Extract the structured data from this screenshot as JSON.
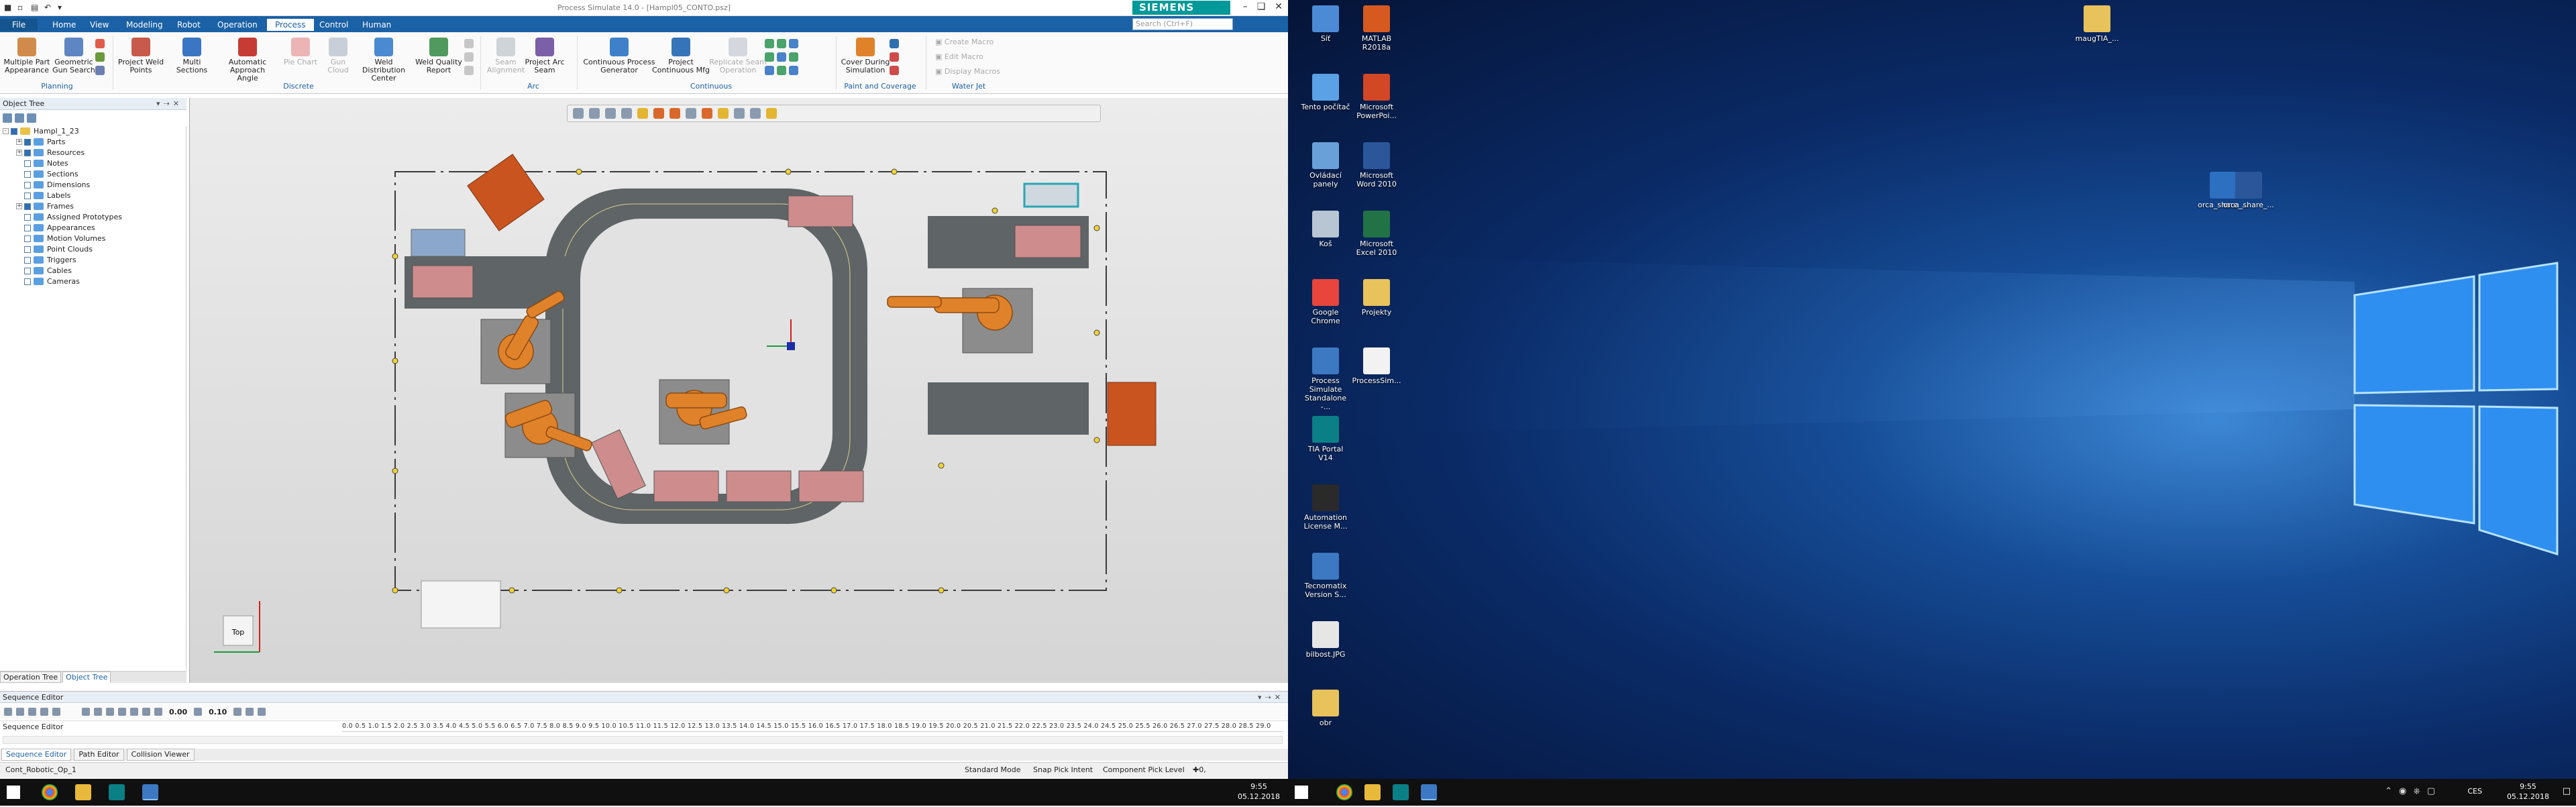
{
  "app": {
    "title": "Process Simulate 14.0 - [Hampl05_CONTO.psz]",
    "brand": "SIEMENS",
    "search_placeholder": "Search (Ctrl+F)",
    "tabs": [
      "File",
      "Home",
      "View",
      "Modeling",
      "Robot",
      "Operation",
      "Process",
      "Control",
      "Human"
    ],
    "active_tab": "Process"
  },
  "ribbon": {
    "buttons": [
      {
        "label": "Multiple Part Appearance",
        "icon": "multiple-part-appearance-icon",
        "disabled": false
      },
      {
        "label": "Geometric Gun Search",
        "icon": "geometric-gun-search-icon",
        "disabled": false
      },
      {
        "label": "Project Weld Points",
        "icon": "project-weld-points-icon",
        "disabled": false
      },
      {
        "label": "Multi Sections",
        "icon": "multi-sections-icon",
        "disabled": false
      },
      {
        "label": "Automatic Approach Angle",
        "icon": "approach-angle-icon",
        "disabled": false
      },
      {
        "label": "Pie Chart",
        "icon": "pie-chart-icon",
        "disabled": true
      },
      {
        "label": "Gun Cloud",
        "icon": "gun-cloud-icon",
        "disabled": true
      },
      {
        "label": "Weld Distribution Center",
        "icon": "weld-distribution-icon",
        "disabled": false
      },
      {
        "label": "Weld Quality Report",
        "icon": "weld-quality-icon",
        "disabled": false
      },
      {
        "label": "Seam Alignment",
        "icon": "seam-alignment-icon",
        "disabled": true
      },
      {
        "label": "Project Arc Seam",
        "icon": "project-arc-seam-icon",
        "disabled": false
      },
      {
        "label": "Continuous Process Generator",
        "icon": "continuous-process-icon",
        "disabled": false
      },
      {
        "label": "Project Continuous Mfg",
        "icon": "project-continuous-icon",
        "disabled": false
      },
      {
        "label": "Replicate Seam Operation",
        "icon": "replicate-seam-icon",
        "disabled": true
      },
      {
        "label": "Cover During Simulation",
        "icon": "cover-simulation-icon",
        "disabled": false
      }
    ],
    "groups": [
      "Planning",
      "Discrete",
      "Arc",
      "Continuous",
      "Paint and Coverage",
      "Water Jet"
    ],
    "macros": [
      "Create Macro",
      "Edit Macro",
      "Display Macros"
    ]
  },
  "object_tree": {
    "header": "Object Tree",
    "root": "Hampl_1_23",
    "items": [
      "Parts",
      "Resources",
      "Notes",
      "Sections",
      "Dimensions",
      "Labels",
      "Frames",
      "Assigned Prototypes",
      "Appearances",
      "Motion Volumes",
      "Point Clouds",
      "Triggers",
      "Cables",
      "Cameras"
    ],
    "tabs": [
      "Operation Tree",
      "Object Tree"
    ]
  },
  "sequence_editor": {
    "header": "Sequence Editor",
    "column": "Sequence Editor",
    "time_current": "0.00",
    "time_step": "0.10",
    "ruler": "0.0 0.5 1.0 1.5 2.0 2.5 3.0 3.5 4.0 4.5 5.0 5.5 6.0 6.5 7.0 7.5 8.0 8.5 9.0 9.5 10.0 10.5 11.0 11.5 12.0 12.5 13.0 13.5 14.0 14.5 15.0 15.5 16.0 16.5 17.0 17.5 18.0 18.5 19.0 19.5 20.0 20.5 21.0 21.5 22.0 22.5 23.0 23.5 24.0 24.5 25.0 25.5 26.0 26.5 27.0 27.5 28.0 28.5 29.0",
    "tabs": [
      "Sequence Editor",
      "Path Editor",
      "Collision Viewer"
    ]
  },
  "statusbar": {
    "operation": "Cont_Robotic_Op_1",
    "mode": "Standard Mode",
    "pick_intent": "Snap Pick Intent",
    "pick_level": "Component Pick Level",
    "coords": "0, 0, 0"
  },
  "taskbar": {
    "time": "9:55",
    "date": "05.12.2018",
    "lang": "CES"
  },
  "viewport": {
    "triad_label": "Top"
  },
  "desktop_icons": [
    {
      "label": "Síť",
      "icon": "network-icon"
    },
    {
      "label": "MATLAB R2018a",
      "icon": "matlab-icon"
    },
    {
      "label": "Tento počítač",
      "icon": "this-pc-icon"
    },
    {
      "label": "Microsoft PowerPoi...",
      "icon": "powerpoint-icon"
    },
    {
      "label": "Ovládací panely",
      "icon": "control-panel-icon"
    },
    {
      "label": "Microsoft Word 2010",
      "icon": "word-icon"
    },
    {
      "label": "Koš",
      "icon": "recycle-bin-icon"
    },
    {
      "label": "Microsoft Excel 2010",
      "icon": "excel-icon"
    },
    {
      "label": "Google Chrome",
      "icon": "chrome-icon"
    },
    {
      "label": "Projekty",
      "icon": "folder-icon"
    },
    {
      "label": "Process Simulate Standalone -...",
      "icon": "process-simulate-icon"
    },
    {
      "label": "ProcessSim...",
      "icon": "document-icon"
    },
    {
      "label": "TIA Portal V14",
      "icon": "tia-portal-icon"
    },
    {
      "label": "Automation License M...",
      "icon": "license-manager-icon"
    },
    {
      "label": "Tecnomatix Version S...",
      "icon": "tecnomatix-icon"
    },
    {
      "label": "bilbost.JPG",
      "icon": "image-icon"
    },
    {
      "label": "obr",
      "icon": "folder-icon"
    },
    {
      "label": "maugTIA_...",
      "icon": "folder-icon"
    },
    {
      "label": "orca_share_...",
      "icon": "pdf-icon"
    },
    {
      "label": "orca_share_...",
      "icon": "word-doc-icon"
    }
  ],
  "right_taskbar": {
    "time": "9:55",
    "date": "05.12.2018",
    "lang": "CES"
  },
  "colors": {
    "brand": "#009999",
    "ribbon_tab": "#1b61a6",
    "robot": "#e0822a",
    "conveyor": "#5f6466"
  }
}
